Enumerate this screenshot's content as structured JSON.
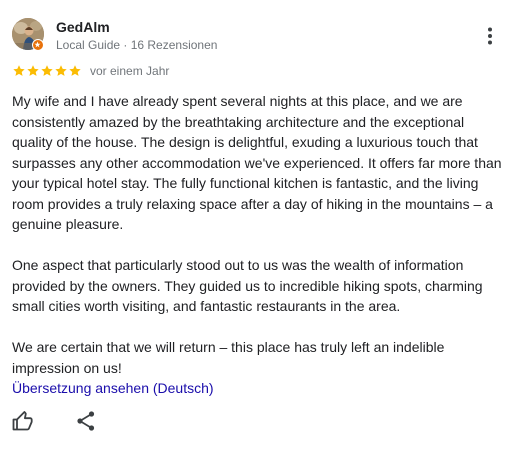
{
  "review": {
    "author": {
      "name": "GedAlm",
      "meta": "Local Guide · 16 Rezensionen",
      "avatar_icon": "user-photo-avatar",
      "badge_icon": "local-guide-badge-icon",
      "badge_color": "#e8710a"
    },
    "rating": {
      "stars": 5,
      "max": 5,
      "star_color": "#fbbc04",
      "date": "vor einem Jahr"
    },
    "paragraphs": [
      "My wife and I have already spent several nights at this place, and we are consistently amazed by the breathtaking architecture and the exceptional quality of the house. The design is delightful, exuding a luxurious touch that surpasses any other accommodation we've experienced. It offers far more than your typical hotel stay. The fully functional kitchen is fantastic, and the living room provides a truly relaxing space after a day of hiking in the mountains – a genuine pleasure.",
      "One aspect that particularly stood out to us was the wealth of information provided by the owners. They guided us to incredible hiking spots, charming small cities worth visiting, and fantastic restaurants in the area.",
      "We are certain that we will return – this place has truly left an indelible impression on us!"
    ],
    "translate_link": "Übersetzung ansehen (Deutsch)",
    "link_color": "#1a0dab",
    "actions": {
      "like_icon": "thumbs-up-icon",
      "share_icon": "share-icon",
      "more_icon": "more-vert-icon"
    }
  }
}
